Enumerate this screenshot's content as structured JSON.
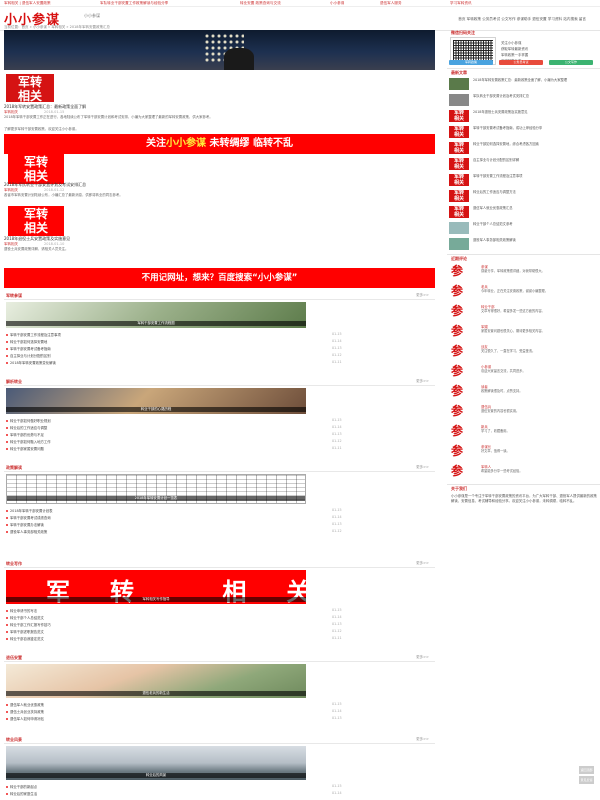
{
  "topbar": {
    "links": [
      "军转相关 | 退伍军人安置政策",
      "军队转业干部安置工作政策解读与经验分享",
      "转业安置 政策查询与交流",
      "小小参谋",
      "退伍军人服务",
      "学习军转资讯"
    ]
  },
  "header": {
    "logo": "小小参谋",
    "subtitle": "小小参谋",
    "right_text": "首页 军转政策 公务员考试 公文写作 参谋助手 退伍安置 学习资料 站内搜索 留言"
  },
  "breadcrumb": "当前位置：首页 » 小小参谋 » 军转相关 » 2018年军转安置政策汇总",
  "main": {
    "stamp": "军转\n相关",
    "post1": {
      "title": "2018年军转安置政策汇总：最新政策全面了解",
      "meta": "军转相关",
      "date": "2018-01-15",
      "text1": "2018年军转干部安置工作正在进行，各地陆续公布了军转干部安置计划和考试安排，小编为大家整理了最新的军转安置政策，供大家参考。",
      "text2": "了解更多军转干部安置政策，欢迎关注小小参谋。"
    },
    "banner1": {
      "prefix": "关注",
      "highlight": "小小参谋",
      "suffix": " 未转绸缪 临转不乱"
    },
    "post2": {
      "title": "2018年军队转业干部安置计划及考试安排汇总",
      "meta": "军转相关",
      "date": "2018-01-12",
      "text": "各省市军转安置计划陆续公布，小编汇总了最新消息，供即将转业的同志参考。"
    },
    "post3": {
      "title": "2018年退役士兵安置政策及实施意见",
      "meta": "军转相关",
      "date": "2018-01-10",
      "text": "退役士兵安置政策详解，请相关人员关注。"
    },
    "banner2": "不用记网址，想来？百度搜索“小小参谋”",
    "sections": [
      {
        "title": "军转参谋",
        "more": "更多>>",
        "caption": "军转干部安置工作流程图",
        "items": [
          {
            "text": "军转干部安置工作流程及注意事项",
            "date": "01-15"
          },
          {
            "text": "转业干部如何选择安置地",
            "date": "01-14"
          },
          {
            "text": "军转干部安置考试备考指南",
            "date": "01-13"
          },
          {
            "text": "自主择业与计划分配的区别",
            "date": "01-12"
          },
          {
            "text": "2018年军转安置政策变化解读",
            "date": "01-11"
          }
        ]
      },
      {
        "title": "解析转业",
        "more": "更多>>",
        "caption": "转业干部的心路历程",
        "items": [
          {
            "text": "转业干部如何做好职业规划",
            "date": "01-15"
          },
          {
            "text": "转业后的工作适应与调整",
            "date": "01-14"
          },
          {
            "text": "军转干部的优势与不足",
            "date": "01-13"
          },
          {
            "text": "转业干部如何融入地方工作",
            "date": "01-12"
          },
          {
            "text": "转业干部家属安置问题",
            "date": "01-11"
          }
        ]
      },
      {
        "title": "政策解读",
        "more": "更多>>",
        "caption": "2018年军转安置计划一览表",
        "items": [
          {
            "text": "2018年军转干部安置计划表",
            "date": "01-15"
          },
          {
            "text": "军转干部安置考试成绩查询",
            "date": "01-14"
          },
          {
            "text": "军转干部安置办法解读",
            "date": "01-13"
          },
          {
            "text": "退役军人事务部相关政策",
            "date": "01-12"
          }
        ]
      },
      {
        "title": "转业写作",
        "more": "更多>>",
        "caption": "军转相关写作指导",
        "items": [
          {
            "text": "转业申请书的写法",
            "date": "01-15"
          },
          {
            "text": "转业干部个人总结范文",
            "date": "01-14"
          },
          {
            "text": "转业干部工作汇报写作技巧",
            "date": "01-13"
          },
          {
            "text": "军转干部述职报告范文",
            "date": "01-12"
          },
          {
            "text": "转业干部自我鉴定范文",
            "date": "01-11"
          }
        ]
      },
      {
        "title": "退伍安置",
        "more": "更多>>",
        "caption": "退伍老兵的新生活",
        "items": [
          {
            "text": "退伍军人就业优惠政策",
            "date": "01-15"
          },
          {
            "text": "退伍士兵创业扶持政策",
            "date": "01-14"
          },
          {
            "text": "退伍军人如何申请补贴",
            "date": "01-13"
          }
        ]
      },
      {
        "title": "转业风景",
        "more": "更多>>",
        "caption": "转业后的风景",
        "items": [
          {
            "text": "转业干部的新起点",
            "date": "01-15"
          },
          {
            "text": "转业后的家庭生活",
            "date": "01-14"
          }
        ]
      }
    ]
  },
  "sidebar": {
    "qr_title": "微信扫码关注",
    "qr_lines": [
      "关注小小参谋",
      "获取军转最新资讯",
      "军转政策一手掌握",
      "欢迎转发分享"
    ],
    "buttons": [
      "军转政策",
      "公务员考试",
      "公文写作"
    ],
    "latest_title": "最新文章",
    "latest": [
      "2018年军转安置政策汇总：最新政策全面了解，小编为大家整理",
      "军队转业干部安置计划及考试安排汇总",
      "2018年退役士兵安置政策及实施意见",
      "军转干部安置考试备考指南，成功上岸经验分享",
      "转业干部如何选择安置地，综合考虑各方因素",
      "自主择业与计划分配的区别详解",
      "军转干部安置工作流程及注意事项",
      "转业后的工作适应与调整方法",
      "退伍军人就业优惠政策汇总",
      "转业干部个人总结范文参考",
      "退役军人事务部相关政策解读"
    ],
    "comments_title": "近期评论",
    "comments": [
      {
        "name": "参谋",
        "text": "感谢分享，军转政策很详细，对我帮助很大。"
      },
      {
        "name": "老兵",
        "text": "今年转业，正在关注安置政策，谢谢小编整理。"
      },
      {
        "name": "转业干部",
        "text": "文章写得很好，希望多发一些这方面的内容。"
      },
      {
        "name": "军嫂",
        "text": "家属安置问题也很关心，期待更多相关内容。"
      },
      {
        "name": "战友",
        "text": "关注很久了，一直在学习，受益匪浅。"
      },
      {
        "name": "小参谋",
        "text": "欢迎大家留言交流，共同进步。"
      },
      {
        "name": "读者",
        "text": "政策解读很及时，点赞支持。"
      },
      {
        "name": "退伍兵",
        "text": "退伍安置的内容也很实用。"
      },
      {
        "name": "新兵",
        "text": "学习了，收藏备用。"
      },
      {
        "name": "参谋长",
        "text": "好文章，值得一读。"
      },
      {
        "name": "军转人",
        "text": "希望能多分享一些考试经验。"
      }
    ],
    "about_title": "关于我们",
    "about": "小小参谋是一个专注于军转干部安置政策的资讯平台，为广大军转干部、退役军人提供最新的政策解读、安置信息、考试辅导和经验分享。欢迎关注小小参谋，未转绸缪，临转不乱。"
  },
  "float": [
    "返回顶部",
    "意见反馈"
  ],
  "colors": {
    "accent": "#d51313",
    "link": "#c33"
  }
}
